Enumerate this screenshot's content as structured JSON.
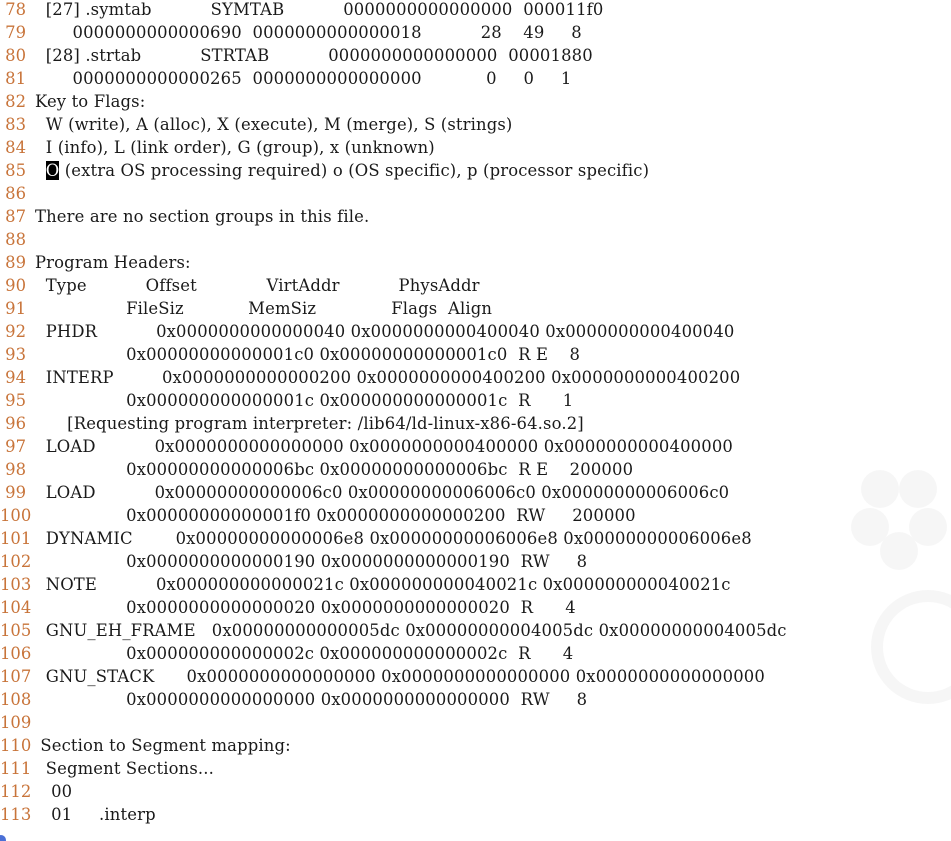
{
  "colors": {
    "line_number": "#c8743a",
    "text": "#1a1a1a",
    "background": "#ffffff",
    "cursor": "#000000"
  },
  "editor": {
    "lines": [
      {
        "num": "78",
        "text": "  [27] .symtab           SYMTAB           0000000000000000  000011f0"
      },
      {
        "num": "79",
        "text": "       0000000000000690  0000000000000018           28    49     8"
      },
      {
        "num": "80",
        "text": "  [28] .strtab           STRTAB           0000000000000000  00001880"
      },
      {
        "num": "81",
        "text": "       0000000000000265  0000000000000000            0     0     1"
      },
      {
        "num": "82",
        "text": "Key to Flags:"
      },
      {
        "num": "83",
        "text": "  W (write), A (alloc), X (execute), M (merge), S (strings)"
      },
      {
        "num": "84",
        "text": "  I (info), L (link order), G (group), x (unknown)"
      },
      {
        "num": "85",
        "cursor_char": "O",
        "text": " (extra OS processing required) o (OS specific), p (processor specific)"
      },
      {
        "num": "86",
        "text": ""
      },
      {
        "num": "87",
        "text": "There are no section groups in this file."
      },
      {
        "num": "88",
        "text": ""
      },
      {
        "num": "89",
        "text": "Program Headers:"
      },
      {
        "num": "90",
        "text": "  Type           Offset             VirtAddr           PhysAddr"
      },
      {
        "num": "91",
        "text": "                 FileSiz            MemSiz              Flags  Align"
      },
      {
        "num": "92",
        "text": "  PHDR           0x0000000000000040 0x0000000000400040 0x0000000000400040"
      },
      {
        "num": "93",
        "text": "                 0x00000000000001c0 0x00000000000001c0  R E    8"
      },
      {
        "num": "94",
        "text": "  INTERP         0x0000000000000200 0x0000000000400200 0x0000000000400200"
      },
      {
        "num": "95",
        "text": "                 0x000000000000001c 0x000000000000001c  R      1"
      },
      {
        "num": "96",
        "text": "      [Requesting program interpreter: /lib64/ld-linux-x86-64.so.2]"
      },
      {
        "num": "97",
        "text": "  LOAD           0x0000000000000000 0x0000000000400000 0x0000000000400000"
      },
      {
        "num": "98",
        "text": "                 0x00000000000006bc 0x00000000000006bc  R E    200000"
      },
      {
        "num": "99",
        "text": "  LOAD           0x00000000000006c0 0x00000000006006c0 0x00000000006006c0"
      },
      {
        "num": "100",
        "text": "                 0x00000000000001f0 0x0000000000000200  RW     200000"
      },
      {
        "num": "101",
        "text": "  DYNAMIC        0x00000000000006e8 0x00000000006006e8 0x00000000006006e8"
      },
      {
        "num": "102",
        "text": "                 0x0000000000000190 0x0000000000000190  RW     8"
      },
      {
        "num": "103",
        "text": "  NOTE           0x000000000000021c 0x000000000040021c 0x000000000040021c"
      },
      {
        "num": "104",
        "text": "                 0x0000000000000020 0x0000000000000020  R      4"
      },
      {
        "num": "105",
        "text": "  GNU_EH_FRAME   0x00000000000005dc 0x00000000004005dc 0x00000000004005dc"
      },
      {
        "num": "106",
        "text": "                 0x000000000000002c 0x000000000000002c  R      4"
      },
      {
        "num": "107",
        "text": "  GNU_STACK      0x0000000000000000 0x0000000000000000 0x0000000000000000"
      },
      {
        "num": "108",
        "text": "                 0x0000000000000000 0x0000000000000000  RW     8"
      },
      {
        "num": "109",
        "text": ""
      },
      {
        "num": "110",
        "text": " Section to Segment mapping:"
      },
      {
        "num": "111",
        "text": "  Segment Sections..."
      },
      {
        "num": "112",
        "text": "   00"
      },
      {
        "num": "113",
        "text": "   01     .interp"
      }
    ]
  }
}
